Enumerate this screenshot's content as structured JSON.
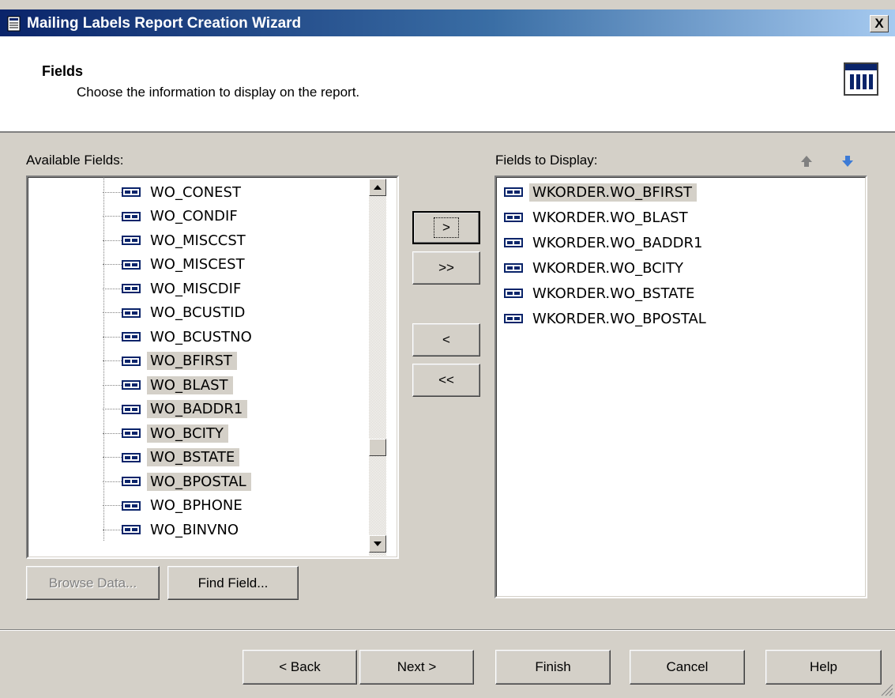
{
  "window": {
    "title": "Mailing Labels Report Creation Wizard",
    "close_label": "X"
  },
  "header": {
    "title": "Fields",
    "subtitle": "Choose the information to display on the report."
  },
  "available": {
    "label": "Available Fields:",
    "items": [
      {
        "label": "WO_CONEST",
        "selected": false
      },
      {
        "label": "WO_CONDIF",
        "selected": false
      },
      {
        "label": "WO_MISCCST",
        "selected": false
      },
      {
        "label": "WO_MISCEST",
        "selected": false
      },
      {
        "label": "WO_MISCDIF",
        "selected": false
      },
      {
        "label": "WO_BCUSTID",
        "selected": false
      },
      {
        "label": "WO_BCUSTNO",
        "selected": false
      },
      {
        "label": "WO_BFIRST",
        "selected": true
      },
      {
        "label": "WO_BLAST",
        "selected": true
      },
      {
        "label": "WO_BADDR1",
        "selected": true
      },
      {
        "label": "WO_BCITY",
        "selected": true
      },
      {
        "label": "WO_BSTATE",
        "selected": true
      },
      {
        "label": "WO_BPOSTAL",
        "selected": true
      },
      {
        "label": "WO_BPHONE",
        "selected": false
      },
      {
        "label": "WO_BINVNO",
        "selected": false
      }
    ]
  },
  "display": {
    "label": "Fields to Display:",
    "items": [
      {
        "label": "WKORDER.WO_BFIRST",
        "selected": true
      },
      {
        "label": "WKORDER.WO_BLAST",
        "selected": false
      },
      {
        "label": "WKORDER.WO_BADDR1",
        "selected": false
      },
      {
        "label": "WKORDER.WO_BCITY",
        "selected": false
      },
      {
        "label": "WKORDER.WO_BSTATE",
        "selected": false
      },
      {
        "label": "WKORDER.WO_BPOSTAL",
        "selected": false
      }
    ]
  },
  "move": {
    "add": ">",
    "add_all": ">>",
    "remove": "<",
    "remove_all": "<<"
  },
  "buttons": {
    "browse_data": "Browse Data...",
    "find_field": "Find Field...",
    "back": "< Back",
    "next": "Next >",
    "finish": "Finish",
    "cancel": "Cancel",
    "help": "Help"
  },
  "icons": {
    "app": "report-icon",
    "wizard": "table-icon",
    "move_up": "up-arrow-icon",
    "move_down": "down-arrow-icon",
    "field": "field-icon"
  },
  "colors": {
    "title_start": "#0a246a",
    "title_end": "#a6caf0",
    "face": "#d4d0c8",
    "arrow_blue": "#3d7bd6"
  }
}
